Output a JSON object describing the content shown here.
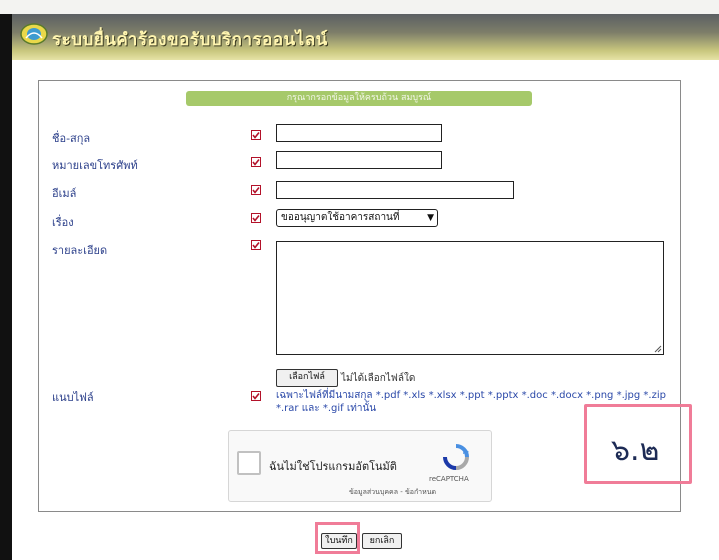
{
  "banner": {
    "title": "ระบบยื่นคำร้องขอรับบริการออนไลน์"
  },
  "form": {
    "notice": "กรุณากรอกข้อมูลให้ครบถ้วน สมบูรณ์",
    "fields": {
      "name": {
        "label": "ชื่อ-สกุล",
        "value": ""
      },
      "phone": {
        "label": "หมายเลขโทรศัพท์",
        "value": ""
      },
      "email": {
        "label": "อีเมล์",
        "value": ""
      },
      "subject": {
        "label": "เรื่อง",
        "selected": "ขออนุญาตใช้อาคารสถานที่"
      },
      "detail": {
        "label": "รายละเอียด",
        "value": ""
      },
      "attachment": {
        "label": "แนบไฟล์",
        "button": "เลือกไฟล์",
        "status": "ไม่ได้เลือกไฟล์ใด",
        "hint": "เฉพาะไฟล์ที่มีนามสกุล *.pdf *.xls *.xlsx *.ppt *.pptx *.doc *.docx *.png *.jpg *.zip *.rar และ *.gif เท่านั้น"
      }
    },
    "captcha": {
      "label": "ฉันไม่ใช่โปรแกรมอัตโนมัติ",
      "brand": "reCAPTCHA",
      "links": "ข้อมูลส่วนบุคคล - ข้อกำหนด"
    },
    "buttons": {
      "submit": "ใบนทึก",
      "cancel": "ยกเลิก"
    }
  },
  "annotation": {
    "marker": "๖.๒"
  },
  "colors": {
    "label": "#2b3f8a",
    "required": "#b3122a",
    "notice_bg": "#a6c96a",
    "highlight": "#f07c98"
  }
}
